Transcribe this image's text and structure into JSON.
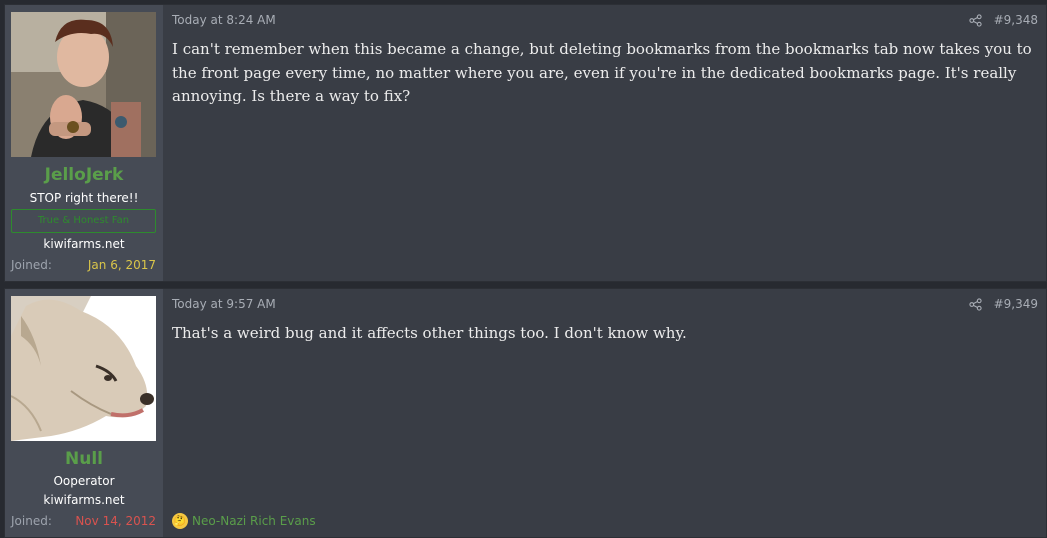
{
  "colors": {
    "username": "#5a9e4a",
    "joined_old": "#d9c54a",
    "joined_red": "#d9534f",
    "banner": "#2e8b2e"
  },
  "posts": [
    {
      "avatar_icon": "avatar-woman-photo",
      "username": "JelloJerk",
      "user_title": "STOP right there!!",
      "banner": "True & Honest Fan",
      "site": "kiwifarms.net",
      "joined_label": "Joined:",
      "joined_date": "Jan 6, 2017",
      "date": "Today at 8:24 AM",
      "post_number": "#9,348",
      "message": "I can't remember when this became a change, but deleting bookmarks from the bookmarks tab now takes you to the front page every time, no matter where you are, even if you're in the dedicated bookmarks page. It's really annoying. Is there a way to fix?"
    },
    {
      "avatar_icon": "avatar-dog-drawing",
      "username": "Null",
      "user_title": "Ooperator",
      "site": "kiwifarms.net",
      "joined_label": "Joined:",
      "joined_date": "Nov 14, 2012",
      "date": "Today at 9:57 AM",
      "post_number": "#9,349",
      "message": "That's a weird bug and it affects other things too. I don't know why.",
      "reaction_icon": "thinking-emoji-icon",
      "reaction_text": "Neo-Nazi Rich Evans"
    }
  ]
}
